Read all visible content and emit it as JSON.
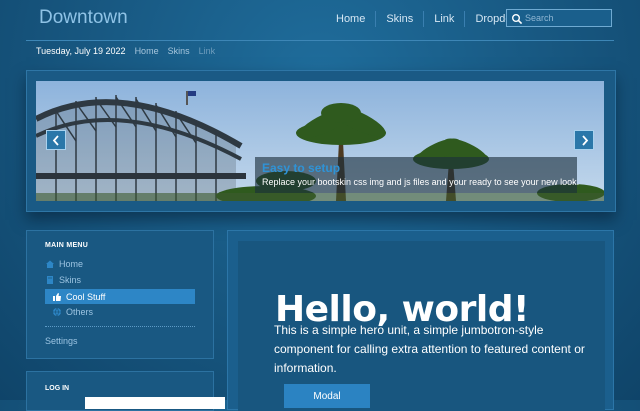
{
  "navbar": {
    "brand": "Downtown",
    "items": [
      "Home",
      "Skins",
      "Link",
      "Dropdown"
    ],
    "search_placeholder": "Search"
  },
  "subbar": {
    "date": "Tuesday, July 19 2022",
    "breadcrumbs": [
      "Home",
      "Skins",
      "Link"
    ]
  },
  "carousel": {
    "caption_title": "Easy to setup",
    "caption_text": "Replace your bootskin css img and js files and your ready to see your new look."
  },
  "sidebar": {
    "header": "MAIN MENU",
    "items": [
      {
        "label": "Home",
        "icon": "home-icon"
      },
      {
        "label": "Skins",
        "icon": "book-icon"
      },
      {
        "label": "Cool Stuff",
        "icon": "thumbs-up-icon",
        "active": true
      },
      {
        "label": "Others",
        "icon": "globe-icon"
      }
    ],
    "settings": "Settings"
  },
  "login": {
    "header": "LOG IN"
  },
  "hero": {
    "title": "Hello, world!",
    "text": "This is a simple hero unit, a simple jumbotron-style component for calling extra attention to featured content or information.",
    "button": "Modal"
  },
  "colors": {
    "background": "#17567f",
    "accent": "#2d86c6",
    "caption_title": "#2f93d6"
  }
}
